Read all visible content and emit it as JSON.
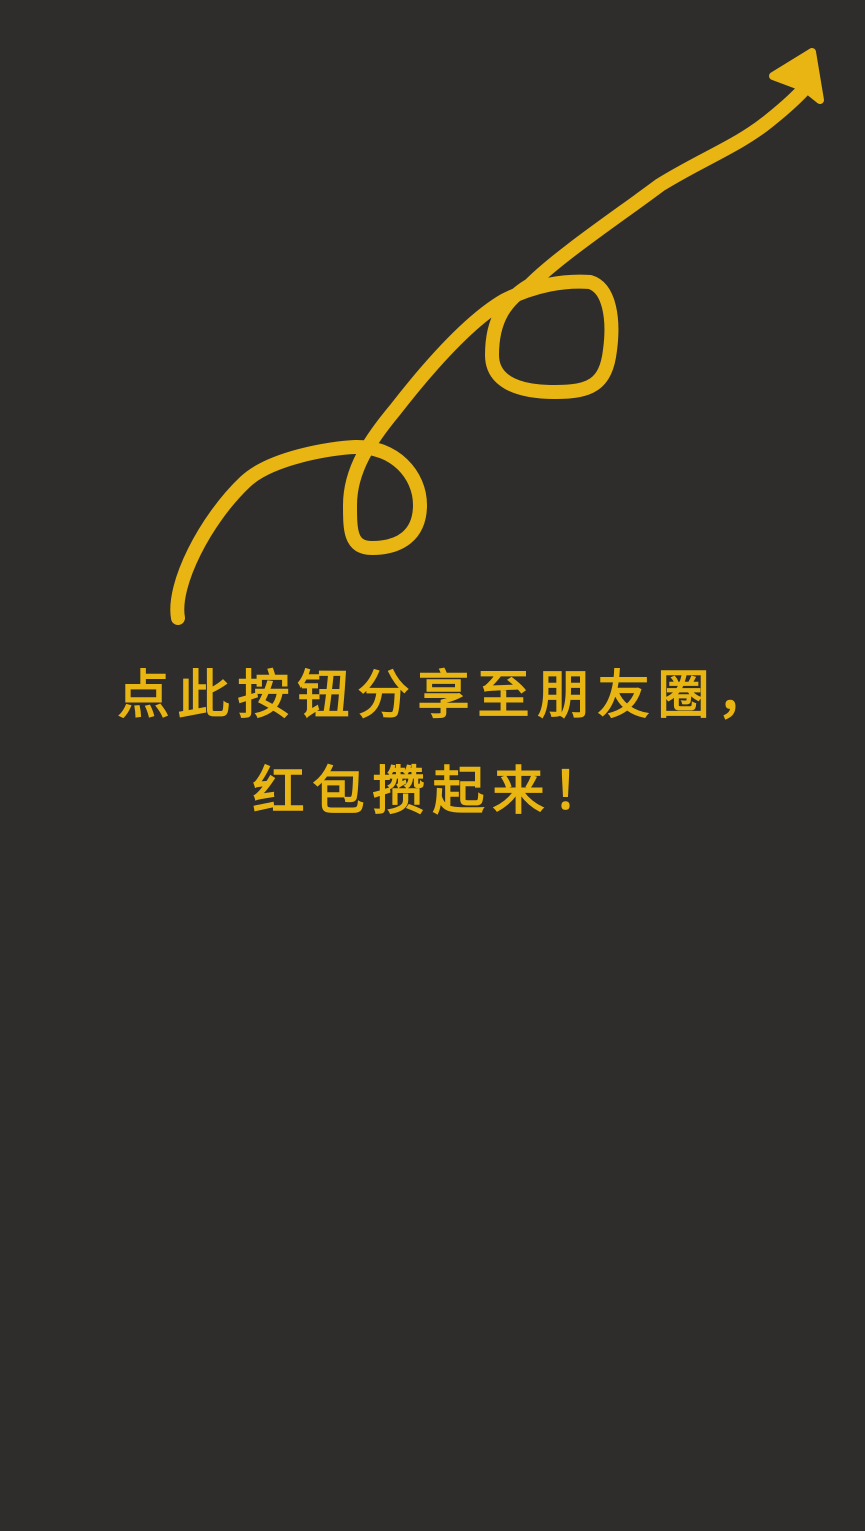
{
  "share_hint": {
    "line1": "点此按钮分享至朋友圈，",
    "line2": "红包攒起来！"
  },
  "colors": {
    "background": "#2e2d2c",
    "accent": "#e8b512"
  },
  "icons": {
    "pointer": "curly-arrow-icon"
  }
}
